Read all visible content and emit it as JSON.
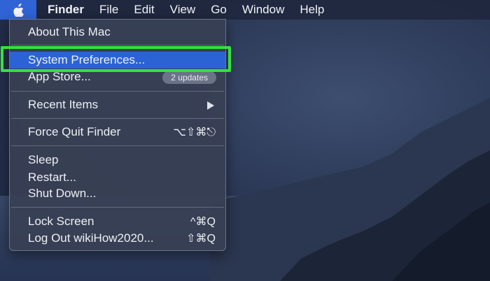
{
  "menubar": {
    "apple_icon": "apple-logo-icon",
    "app_name": "Finder",
    "items": [
      "File",
      "Edit",
      "View",
      "Go",
      "Window",
      "Help"
    ]
  },
  "apple_menu": {
    "about": "About This Mac",
    "system_prefs": "System Preferences...",
    "app_store": "App Store...",
    "app_store_badge": "2 updates",
    "recent_items": "Recent Items",
    "force_quit": "Force Quit Finder",
    "force_quit_shortcut": "⌥⇧⌘⎋",
    "sleep": "Sleep",
    "restart": "Restart...",
    "shut_down": "Shut Down...",
    "lock_screen": "Lock Screen",
    "lock_screen_shortcut": "^⌘Q",
    "log_out": "Log Out wikiHow2020...",
    "log_out_shortcut": "⇧⌘Q"
  },
  "colors": {
    "highlight": "#2b63d4",
    "callout_green": "#33e33c",
    "menu_bg": "#384054"
  }
}
